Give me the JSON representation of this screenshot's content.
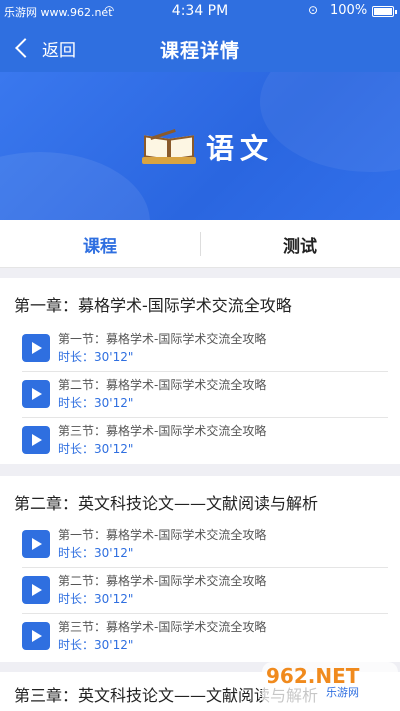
{
  "status": {
    "site": "乐游网 www.962.net",
    "time": "4:34 PM",
    "battery": "100%"
  },
  "nav": {
    "back_label": "返回",
    "title": "课程详情"
  },
  "banner": {
    "subject": "语文"
  },
  "tabs": [
    {
      "label": "课程"
    },
    {
      "label": "测试"
    }
  ],
  "chapters": [
    {
      "title": "第一章：募格学术-国际学术交流全攻略",
      "lessons": [
        {
          "name": "第一节：募格学术-国际学术交流全攻略",
          "duration": "时长：30'12\""
        },
        {
          "name": "第二节：募格学术-国际学术交流全攻略",
          "duration": "时长：30'12\""
        },
        {
          "name": "第三节：募格学术-国际学术交流全攻略",
          "duration": "时长：30'12\""
        }
      ]
    },
    {
      "title": "第二章：英文科技论文——文献阅读与解析",
      "lessons": [
        {
          "name": "第一节：募格学术-国际学术交流全攻略",
          "duration": "时长：30'12\""
        },
        {
          "name": "第二节：募格学术-国际学术交流全攻略",
          "duration": "时长：30'12\""
        },
        {
          "name": "第三节：募格学术-国际学术交流全攻略",
          "duration": "时长：30'12\""
        }
      ]
    },
    {
      "title": "第三章：英文科技论文——文献阅读与解析"
    }
  ],
  "watermark": {
    "logo": "962.NET",
    "sub": "乐游网"
  },
  "colors": {
    "accent": "#2f6fe0",
    "background": "#efeff4"
  }
}
